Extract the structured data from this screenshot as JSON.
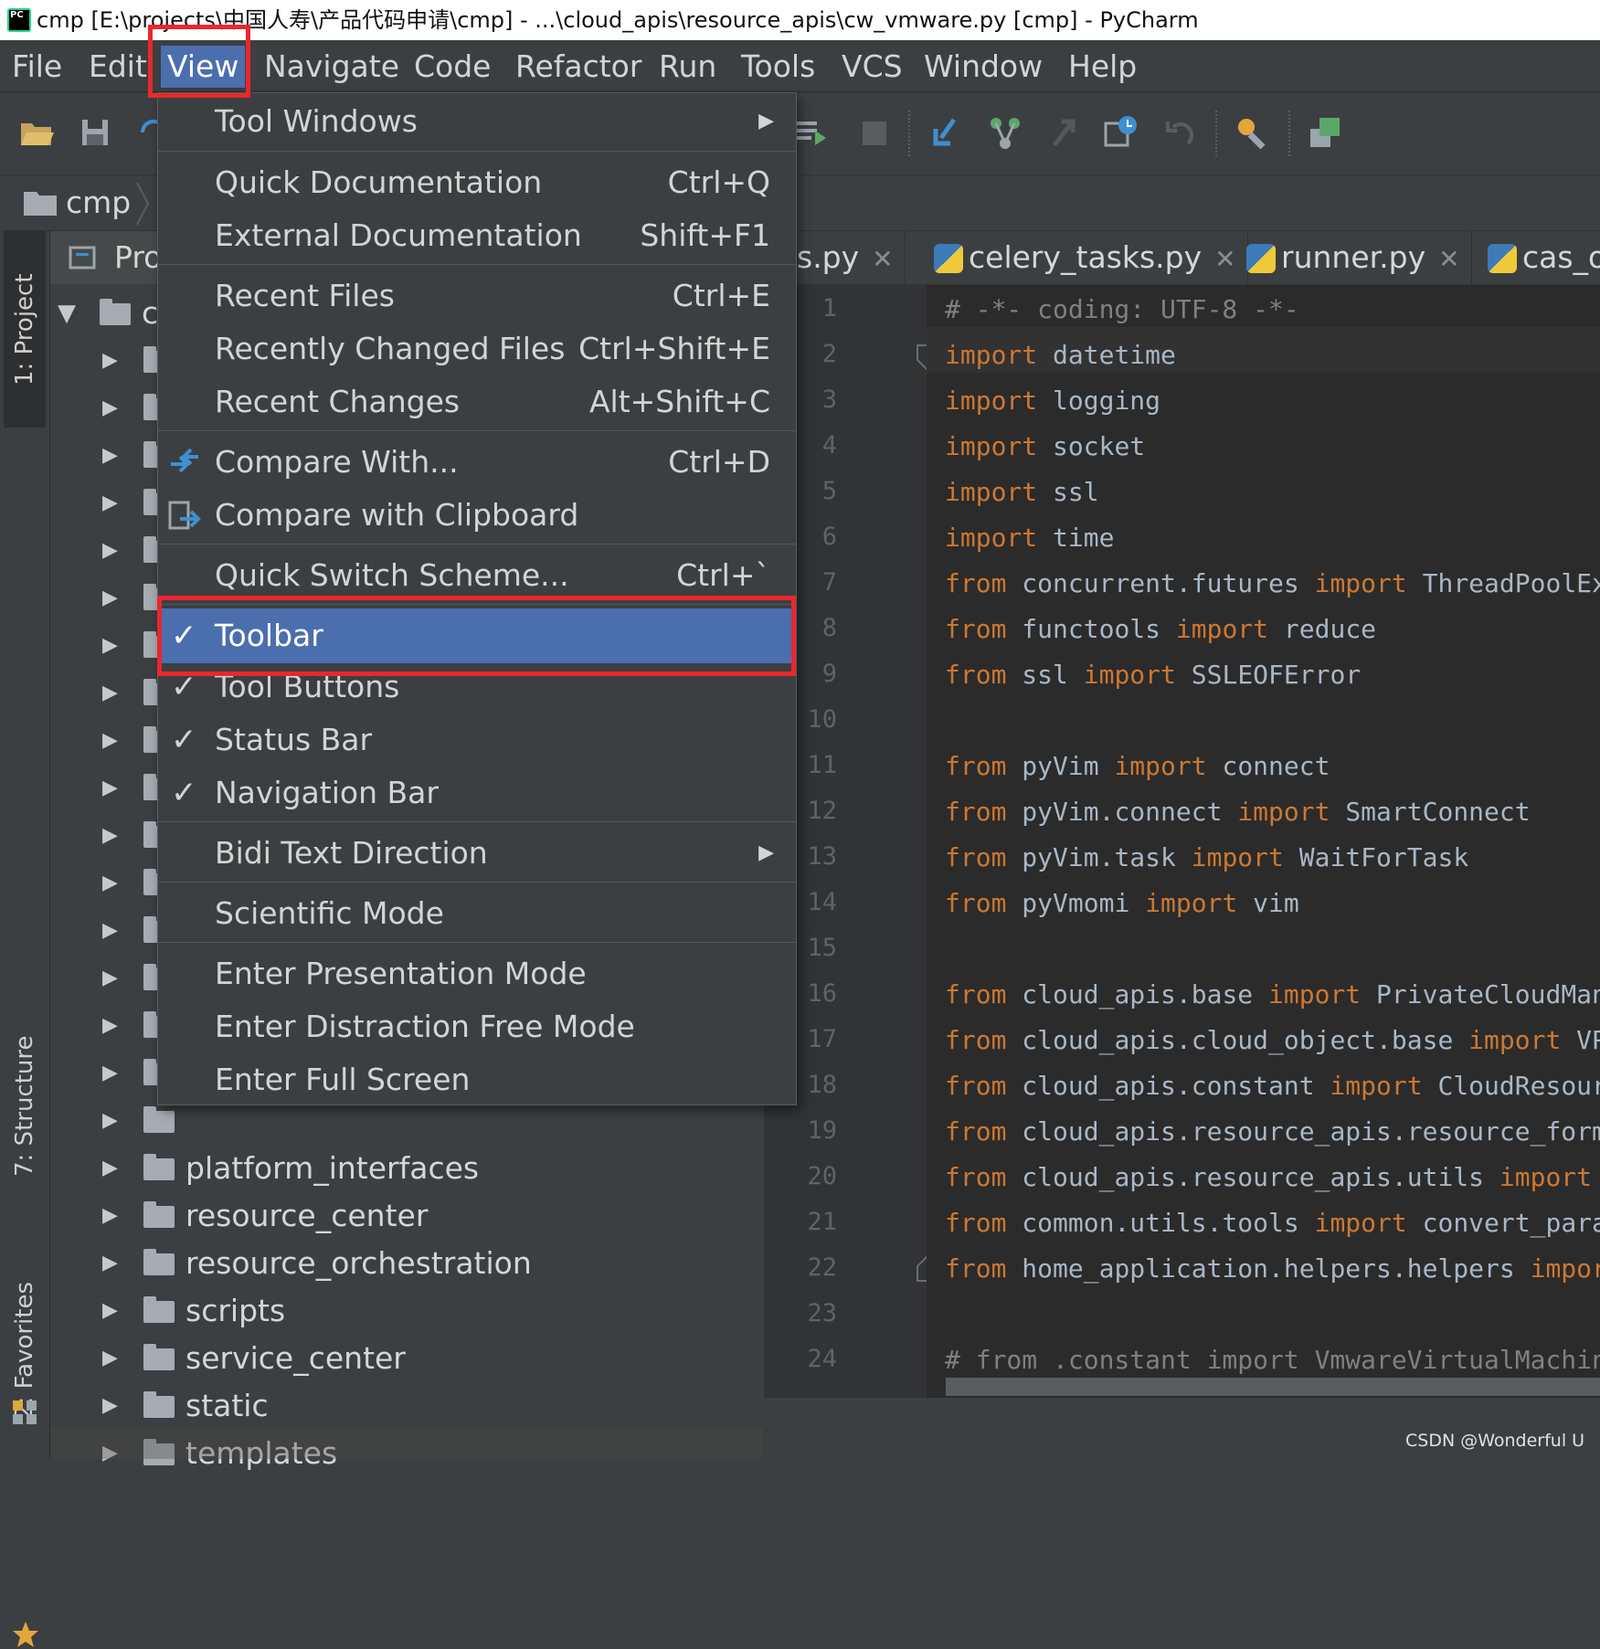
{
  "window": {
    "title": "cmp [E:\\projects\\中国人寿\\产品代码申请\\cmp] - ...\\cloud_apis\\resource_apis\\cw_vmware.py [cmp] - PyCharm"
  },
  "menubar": {
    "items": [
      "File",
      "Edit",
      "View",
      "Navigate",
      "Code",
      "Refactor",
      "Run",
      "Tools",
      "VCS",
      "Window",
      "Help"
    ],
    "active": "View"
  },
  "navbar": {
    "project": "cmp"
  },
  "side_tabs": {
    "project": "1: Project",
    "structure": "7: Structure",
    "favorites": "2: Favorites"
  },
  "project_panel": {
    "header": "Pro",
    "root": "c",
    "visible_folders": [
      "platform_interfaces",
      "resource_center",
      "resource_orchestration",
      "scripts",
      "service_center",
      "static",
      "templates"
    ]
  },
  "view_menu": {
    "items": [
      {
        "label": "Tool Windows",
        "shortcut": "",
        "submenu": true
      },
      {
        "label": "Quick Documentation",
        "shortcut": "Ctrl+Q"
      },
      {
        "label": "External Documentation",
        "shortcut": "Shift+F1"
      },
      {
        "label": "Recent Files",
        "shortcut": "Ctrl+E"
      },
      {
        "label": "Recently Changed Files",
        "shortcut": "Ctrl+Shift+E"
      },
      {
        "label": "Recent Changes",
        "shortcut": "Alt+Shift+C"
      },
      {
        "label": "Compare With...",
        "shortcut": "Ctrl+D",
        "icon": "compare-icon"
      },
      {
        "label": "Compare with Clipboard",
        "shortcut": "",
        "icon": "compare-clipboard-icon"
      },
      {
        "label": "Quick Switch Scheme...",
        "shortcut": "Ctrl+`"
      },
      {
        "label": "Toolbar",
        "checked": true,
        "selected": true
      },
      {
        "label": "Tool Buttons",
        "checked": true
      },
      {
        "label": "Status Bar",
        "checked": true
      },
      {
        "label": "Navigation Bar",
        "checked": true
      },
      {
        "label": "Bidi Text Direction",
        "submenu": true
      },
      {
        "label": "Scientific Mode"
      },
      {
        "label": "Enter Presentation Mode"
      },
      {
        "label": "Enter Distraction Free Mode"
      },
      {
        "label": "Enter Full Screen"
      }
    ]
  },
  "editor": {
    "tabs": [
      "s.py",
      "celery_tasks.py",
      "runner.py",
      "cas_op"
    ],
    "line_numbers": [
      "1",
      "2",
      "3",
      "4",
      "5",
      "6",
      "7",
      "8",
      "9",
      "10",
      "11",
      "12",
      "13",
      "14",
      "15",
      "16",
      "17",
      "18",
      "19",
      "20",
      "21",
      "22",
      "23",
      "24"
    ],
    "lines": [
      "# -*- coding: UTF-8 -*-",
      "import datetime",
      "import logging",
      "import socket",
      "import ssl",
      "import time",
      "from concurrent.futures import ThreadPoolExec",
      "from functools import reduce",
      "from ssl import SSLEOFError",
      "",
      "from pyVim import connect",
      "from pyVim.connect import SmartConnect",
      "from pyVim.task import WaitForTask",
      "from pyVmomi import vim",
      "",
      "from cloud_apis.base import PrivateCloudManag",
      "from cloud_apis.cloud_object.base import VPC,",
      "from cloud_apis.constant import CloudResource",
      "from cloud_apis.resource_apis.resource_format",
      "from cloud_apis.resource_apis.utils import su",
      "from common.utils.tools import convert_param_",
      "from home_application.helpers.helpers import",
      "",
      "# from .constant import VmwareVirtualMachineS"
    ]
  },
  "watermark": "CSDN @Wonderful U",
  "colors": {
    "accent": "#4b6eaf",
    "highlight_box": "#e8272f",
    "keyword": "#cc7832",
    "comment": "#808080"
  }
}
